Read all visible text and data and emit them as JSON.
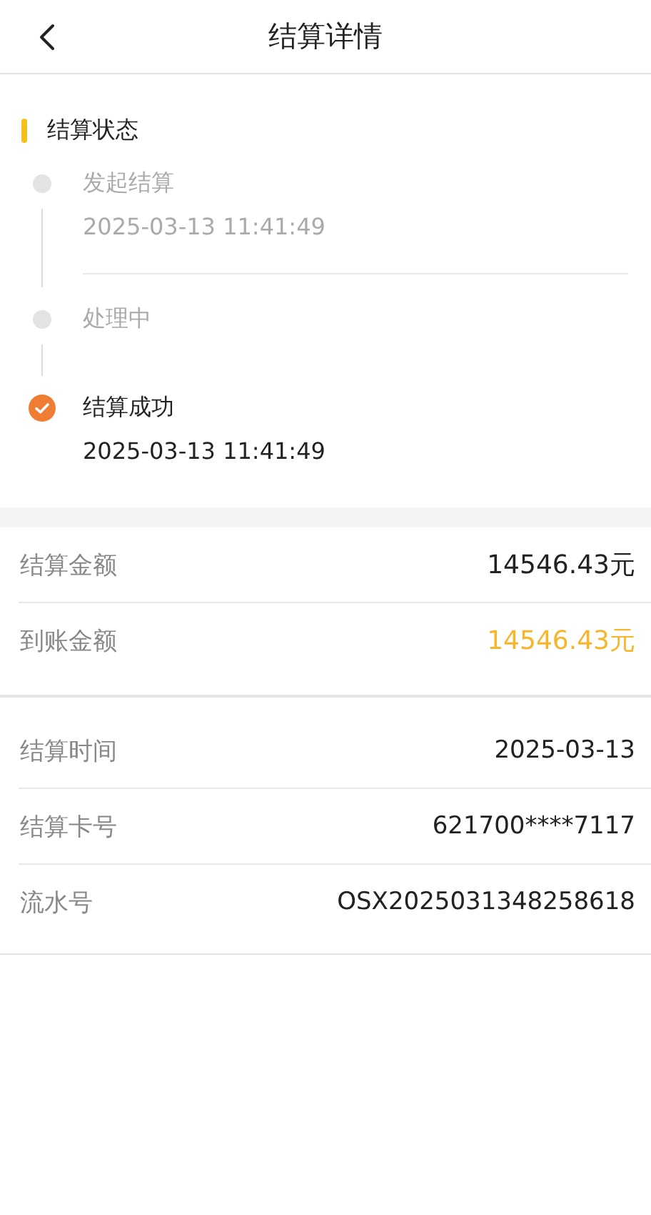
{
  "header": {
    "title": "结算详情"
  },
  "status": {
    "heading": "结算状态",
    "steps": [
      {
        "label": "发起结算",
        "time": "2025-03-13 11:41:49",
        "completed": false
      },
      {
        "label": "处理中",
        "completed": false
      },
      {
        "label": "结算成功",
        "time": "2025-03-13 11:41:49",
        "completed": true
      }
    ]
  },
  "amounts": [
    {
      "label": "结算金额",
      "value": "14546.43元",
      "highlight": false
    },
    {
      "label": "到账金额",
      "value": "14546.43元",
      "highlight": true
    }
  ],
  "details": [
    {
      "label": "结算时间",
      "value": "2025-03-13"
    },
    {
      "label": "结算卡号",
      "value": "621700****7117"
    },
    {
      "label": "流水号",
      "value": "OSX2025031348258618"
    }
  ]
}
